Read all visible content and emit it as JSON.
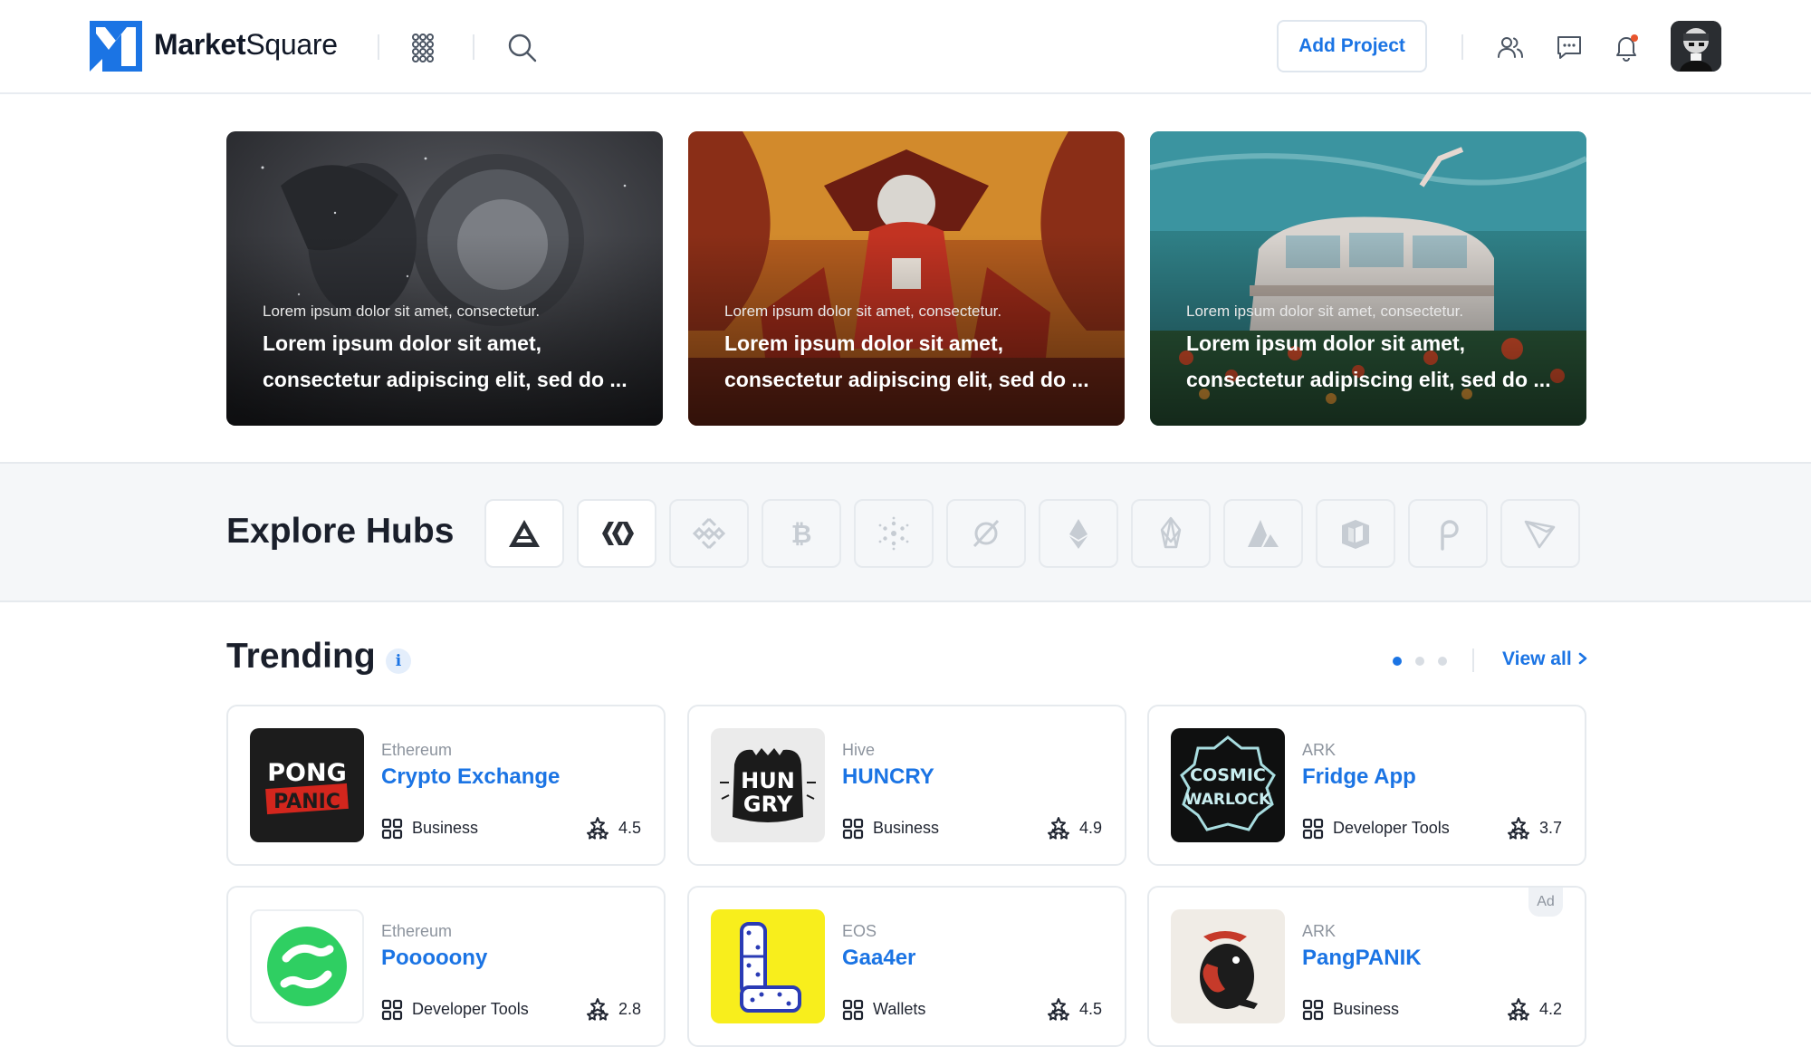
{
  "header": {
    "logo_bold": "Market",
    "logo_light": "Square",
    "add_project_label": "Add Project",
    "icons": [
      "apps-grid-icon",
      "search-icon",
      "users-icon",
      "chat-icon",
      "bell-icon"
    ],
    "notification_dot_color": "#e8552d"
  },
  "banners": [
    {
      "subtitle": "Lorem ipsum dolor sit amet, consectetur.",
      "title": "Lorem ipsum dolor sit amet, consectetur adipiscing elit, sed do ..."
    },
    {
      "subtitle": "Lorem ipsum dolor sit amet, consectetur.",
      "title": "Lorem ipsum dolor sit amet, consectetur adipiscing elit, sed do ..."
    },
    {
      "subtitle": "Lorem ipsum dolor sit amet, consectetur.",
      "title": "Lorem ipsum dolor sit amet, consectetur adipiscing elit, sed do ..."
    }
  ],
  "hubs": {
    "title": "Explore Hubs",
    "items": [
      "ark-icon",
      "hive-icon",
      "binance-icon",
      "bitcoin-icon",
      "cardano-icon",
      "zero-icon",
      "ethereum-icon",
      "eos-icon",
      "avalanche-icon",
      "cube-icon",
      "polkadot-icon",
      "tron-icon"
    ]
  },
  "trending": {
    "title": "Trending",
    "info": "i",
    "view_all": "View all",
    "page_count": 3,
    "active_page": 1,
    "cards": [
      {
        "chain": "Ethereum",
        "name": "Crypto Exchange",
        "category": "Business",
        "rating": "4.5",
        "ad": ""
      },
      {
        "chain": "Hive",
        "name": "HUNCRY",
        "category": "Business",
        "rating": "4.9",
        "ad": ""
      },
      {
        "chain": "ARK",
        "name": "Fridge App",
        "category": "Developer Tools",
        "rating": "3.7",
        "ad": ""
      },
      {
        "chain": "Ethereum",
        "name": "Pooooony",
        "category": "Developer Tools",
        "rating": "2.8",
        "ad": ""
      },
      {
        "chain": "EOS",
        "name": "Gaa4er",
        "category": "Wallets",
        "rating": "4.5",
        "ad": ""
      },
      {
        "chain": "ARK",
        "name": "PangPANIK",
        "category": "Business",
        "rating": "4.2",
        "ad": "Ad"
      }
    ]
  },
  "thumb_logos": {
    "pong": [
      "PONG",
      "PANIC"
    ],
    "hungry": [
      "HUN",
      "GRY"
    ],
    "cosmic": [
      "COSMIC",
      "WARLOCK"
    ]
  },
  "colors": {
    "accent": "#1b74e4",
    "text": "#1a1f2b",
    "muted": "#8d949e",
    "border": "#e6eaee"
  }
}
